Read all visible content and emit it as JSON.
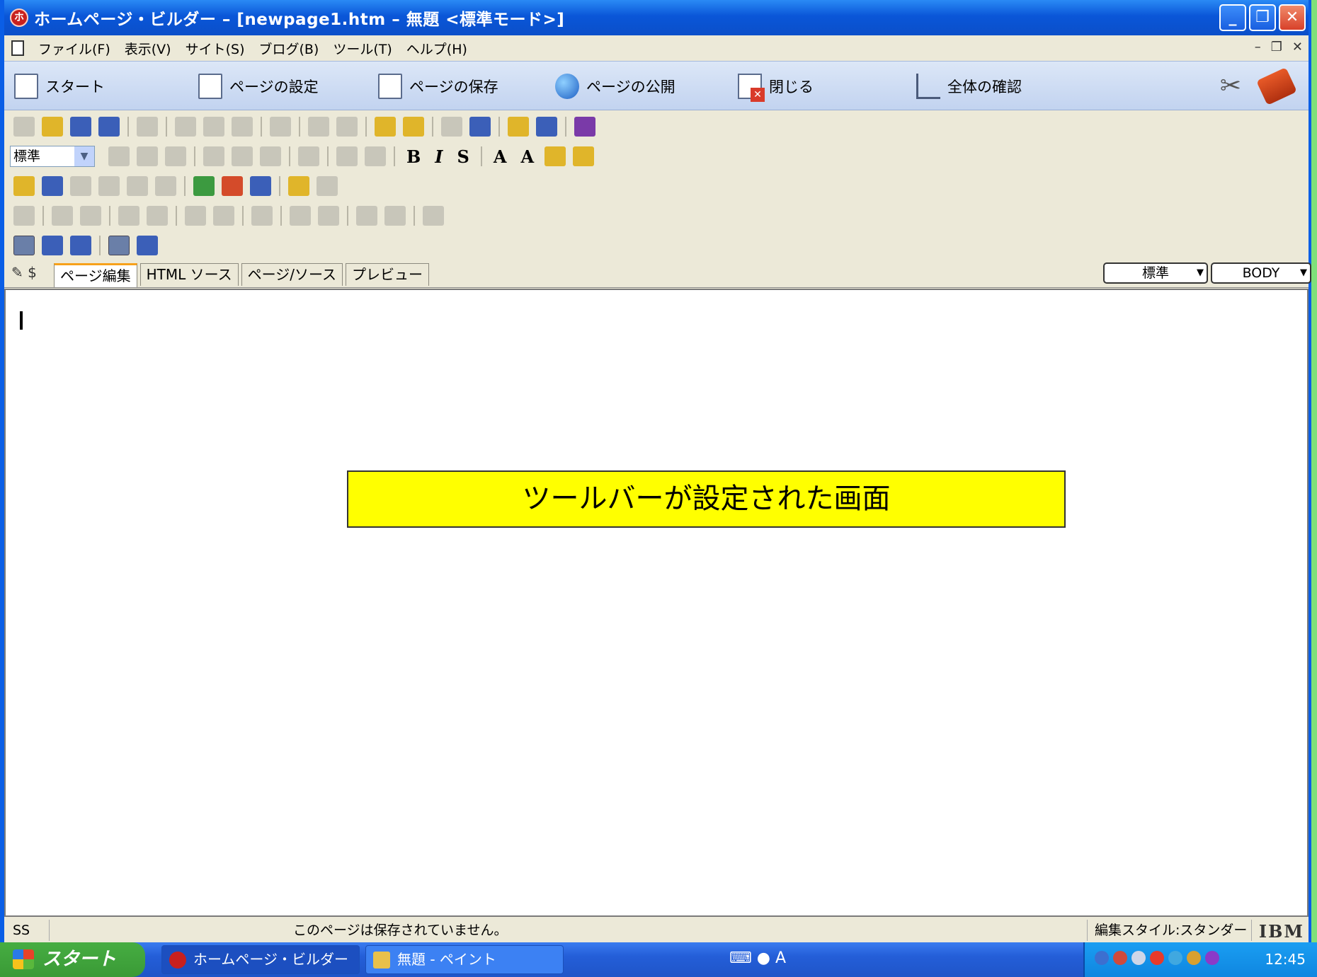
{
  "window": {
    "title": "ホームページ・ビルダー – [newpage1.htm – 無題 <標準モード>]"
  },
  "menu": [
    "ファイル(F)",
    "表示(V)",
    "サイト(S)",
    "ブログ(B)",
    "ツール(T)",
    "ヘルプ(H)"
  ],
  "main_toolbar": [
    {
      "label": "スタート",
      "icon": "start-page-icon"
    },
    {
      "label": "ページの設定",
      "icon": "page-settings-icon"
    },
    {
      "label": "ページの保存",
      "icon": "page-save-icon"
    },
    {
      "label": "ページの公開",
      "icon": "page-publish-icon"
    },
    {
      "label": "閉じる",
      "icon": "close-page-icon"
    },
    {
      "label": "全体の確認",
      "icon": "site-check-icon"
    }
  ],
  "format": {
    "style_select": "標準"
  },
  "tabs": [
    "ページ編集",
    "HTML ソース",
    "ページ/ソース",
    "プレビュー"
  ],
  "selectors": {
    "style": "標準",
    "tag": "BODY"
  },
  "editor": {
    "banner_text": "ツールバーが設定された画面"
  },
  "status": {
    "mode": "SS",
    "message": "このページは保存されていません。",
    "edit_style": "編集スタイル:スタンダード",
    "logo": "IBM"
  },
  "taskbar": {
    "start_label": "スタート",
    "tasks": [
      "ホームページ・ビルダー ...",
      "無題 - ペイント"
    ],
    "ime_label": "A",
    "clock": "12:45"
  },
  "colors": {
    "banner_bg": "#ffff00",
    "titlebar": "#0a56d8",
    "desktop": "#7fe07a"
  }
}
